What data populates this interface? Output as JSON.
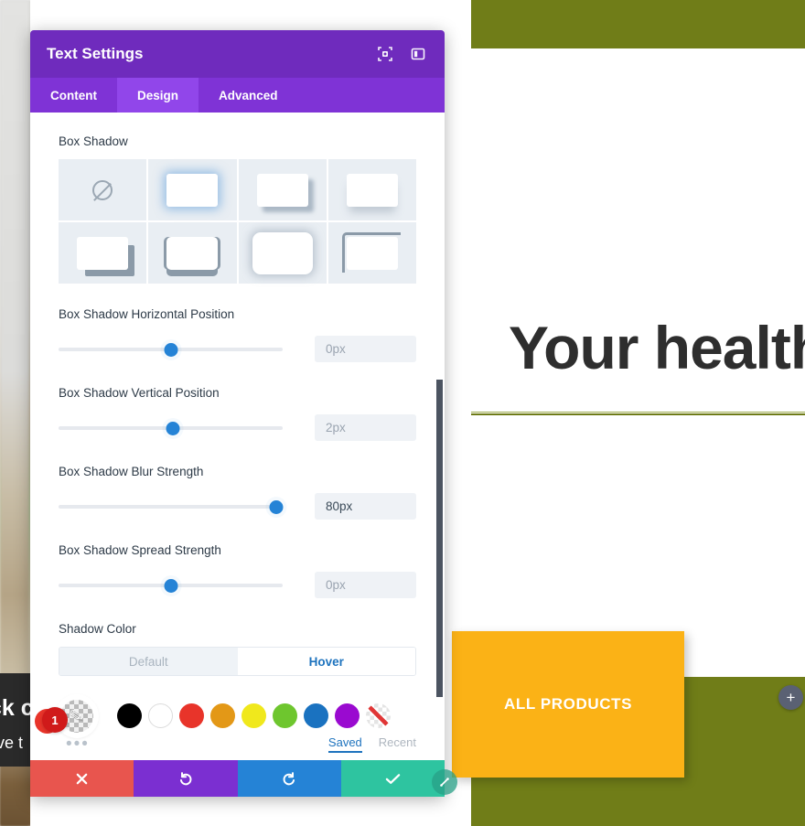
{
  "website": {
    "hero_heading": "Your health",
    "all_products_label": "ALL PRODUCTS",
    "add_button_label": "+",
    "overlay_line1": "ck c",
    "overlay_line2": "ove t",
    "colors": {
      "olive": "#707d18",
      "orange": "#fbb216",
      "heading_text": "#2e2e2e"
    }
  },
  "modal": {
    "title": "Text Settings",
    "header_icons": [
      {
        "name": "focus-target-icon"
      },
      {
        "name": "layout-panel-icon"
      }
    ],
    "tabs": [
      {
        "label": "Content",
        "active": false
      },
      {
        "label": "Design",
        "active": true
      },
      {
        "label": "Advanced",
        "active": false
      }
    ],
    "accent_purple": "#6f2bbd",
    "box_shadow": {
      "label": "Box Shadow",
      "presets": [
        {
          "name": "none",
          "selected": false
        },
        {
          "name": "glow",
          "selected": true
        },
        {
          "name": "offset-bottom-right",
          "selected": false
        },
        {
          "name": "soft-bottom",
          "selected": false
        },
        {
          "name": "hard-corner",
          "selected": false
        },
        {
          "name": "bottom-bar",
          "selected": false
        },
        {
          "name": "outer-blur",
          "selected": false
        },
        {
          "name": "outline-corner",
          "selected": false
        }
      ]
    },
    "sliders": [
      {
        "label": "Box Shadow Horizontal Position",
        "value": "0px",
        "placeholder": "0px",
        "is_placeholder": true,
        "percent": 50
      },
      {
        "label": "Box Shadow Vertical Position",
        "value": "2px",
        "placeholder": "2px",
        "is_placeholder": true,
        "percent": 51
      },
      {
        "label": "Box Shadow Blur Strength",
        "value": "80px",
        "placeholder": "80px",
        "is_placeholder": false,
        "percent": 97
      },
      {
        "label": "Box Shadow Spread Strength",
        "value": "0px",
        "placeholder": "0px",
        "is_placeholder": true,
        "percent": 50
      }
    ],
    "shadow_color": {
      "label": "Shadow Color",
      "states": [
        {
          "label": "Default",
          "active": false
        },
        {
          "label": "Hover",
          "active": true
        }
      ],
      "active_swatch": {
        "name": "eyedropper-transparent",
        "badge": "1"
      },
      "swatches": [
        {
          "name": "swatch-black",
          "hex": "#000000"
        },
        {
          "name": "swatch-white",
          "hex": "#ffffff"
        },
        {
          "name": "swatch-red",
          "hex": "#e8342a"
        },
        {
          "name": "swatch-orange",
          "hex": "#e39817"
        },
        {
          "name": "swatch-yellow",
          "hex": "#f0e81c"
        },
        {
          "name": "swatch-green",
          "hex": "#6ec62e"
        },
        {
          "name": "swatch-blue",
          "hex": "#1a72c0"
        },
        {
          "name": "swatch-purple",
          "hex": "#9a0ad0"
        },
        {
          "name": "swatch-transparent",
          "hex": "transparent"
        }
      ],
      "more_options": "•••",
      "links": [
        {
          "label": "Saved",
          "active": true
        },
        {
          "label": "Recent",
          "active": false
        }
      ]
    },
    "actions": [
      {
        "name": "cancel",
        "glyph": "✖",
        "color": "#e8554e"
      },
      {
        "name": "undo",
        "glyph": "↺",
        "color": "#7b2fd1"
      },
      {
        "name": "redo",
        "glyph": "↻",
        "color": "#2583d6"
      },
      {
        "name": "save",
        "glyph": "✔",
        "color": "#2ec4a0"
      }
    ],
    "resize_handle_glyph": "⤡"
  }
}
